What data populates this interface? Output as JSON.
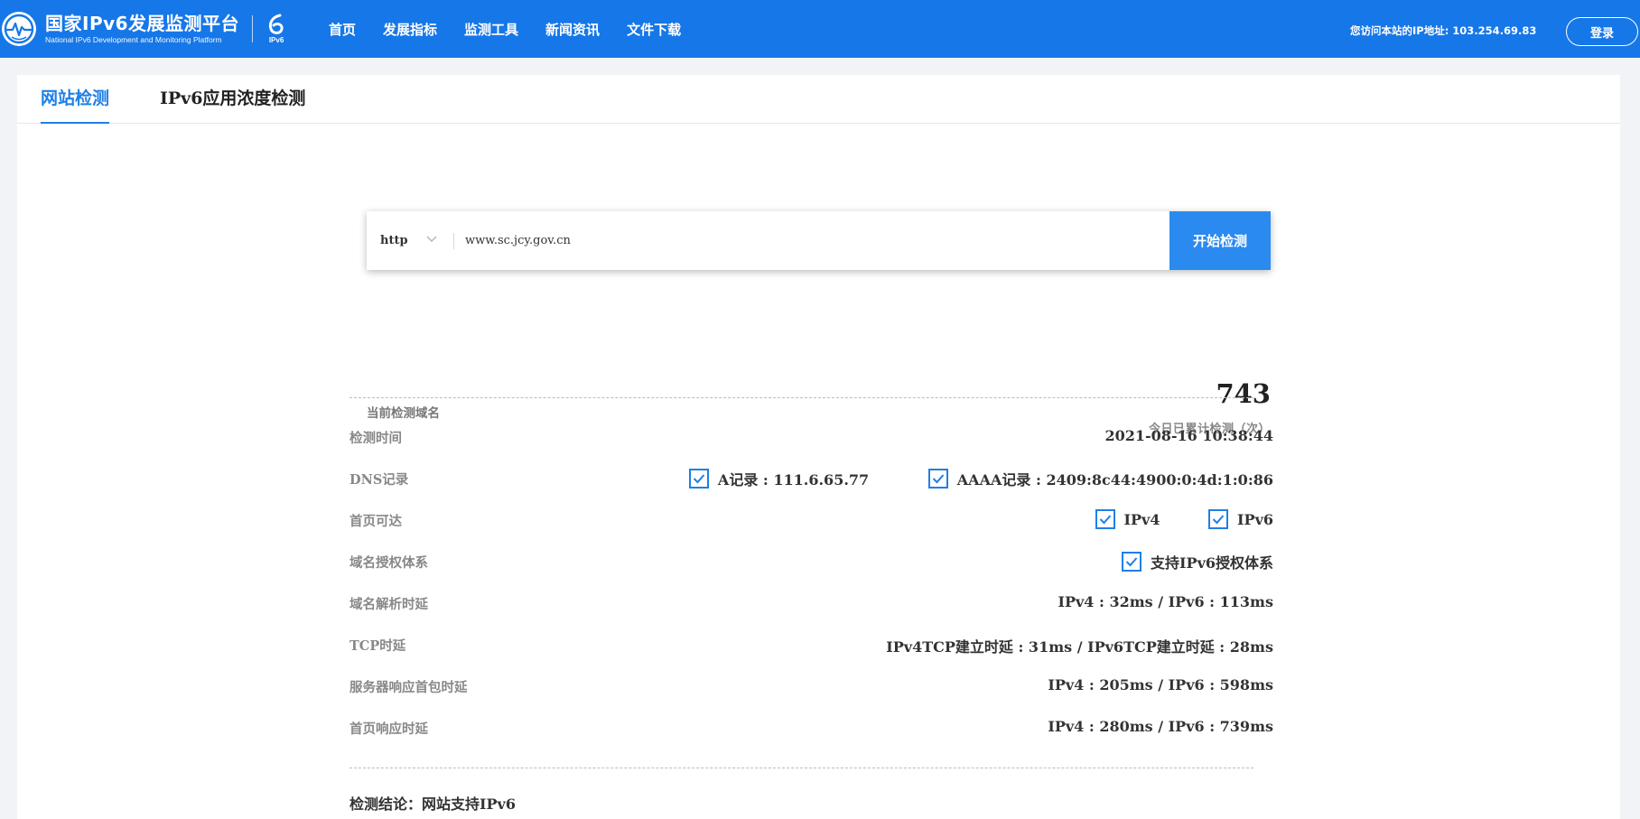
{
  "header": {
    "title": "国家IPv6发展监测平台",
    "subtitle": "National IPv6 Development and Monitoring Platform",
    "badge_label": "IPv6",
    "nav": [
      {
        "label": "首页"
      },
      {
        "label": "发展指标"
      },
      {
        "label": "监测工具"
      },
      {
        "label": "新闻资讯"
      },
      {
        "label": "文件下载"
      }
    ],
    "ip_text": "您访问本站的IP地址: 103.254.69.83",
    "login_label": "登录",
    "colors": {
      "bar": "#1677e8"
    }
  },
  "tabs": [
    {
      "label": "网站检测",
      "active": true
    },
    {
      "label": "IPv6应用浓度检测",
      "active": false
    }
  ],
  "search": {
    "protocol": "http",
    "value": "www.sc.jcy.gov.cn",
    "button_label": "开始检测"
  },
  "summary": {
    "domain_label": "当前检测域名",
    "count": "743",
    "count_label": "今日已累计检测（次）"
  },
  "rows": {
    "time": {
      "label": "检测时间",
      "value": "2021-08-16 10:38:44"
    },
    "dns": {
      "label": "DNS记录",
      "a_record": "A记录 : 111.6.65.77",
      "aaaa_record": "AAAA记录 : 2409:8c44:4900:0:4d:1:0:86"
    },
    "reachable": {
      "label": "首页可达",
      "ipv4": "IPv4",
      "ipv6": "IPv6"
    },
    "auth": {
      "label": "域名授权体系",
      "value": "支持IPv6授权体系"
    },
    "dns_delay": {
      "label": "域名解析时延",
      "value": "IPv4 : 32ms / IPv6 : 113ms"
    },
    "tcp_delay": {
      "label": "TCP时延",
      "value": "IPv4TCP建立时延 : 31ms / IPv6TCP建立时延 : 28ms"
    },
    "server_delay": {
      "label": "服务器响应首包时延",
      "value": "IPv4 : 205ms / IPv6 : 598ms"
    },
    "page_delay": {
      "label": "首页响应时延",
      "value": "IPv4 : 280ms / IPv6 : 739ms"
    }
  },
  "conclusion": "检测结论：网站支持IPv6",
  "icons": [
    "logo-icon",
    "ipv6-logo-icon",
    "chevron-down-icon",
    "check-icon"
  ],
  "colors": {
    "accent": "#1f7fe6",
    "button": "#2b8af0"
  }
}
